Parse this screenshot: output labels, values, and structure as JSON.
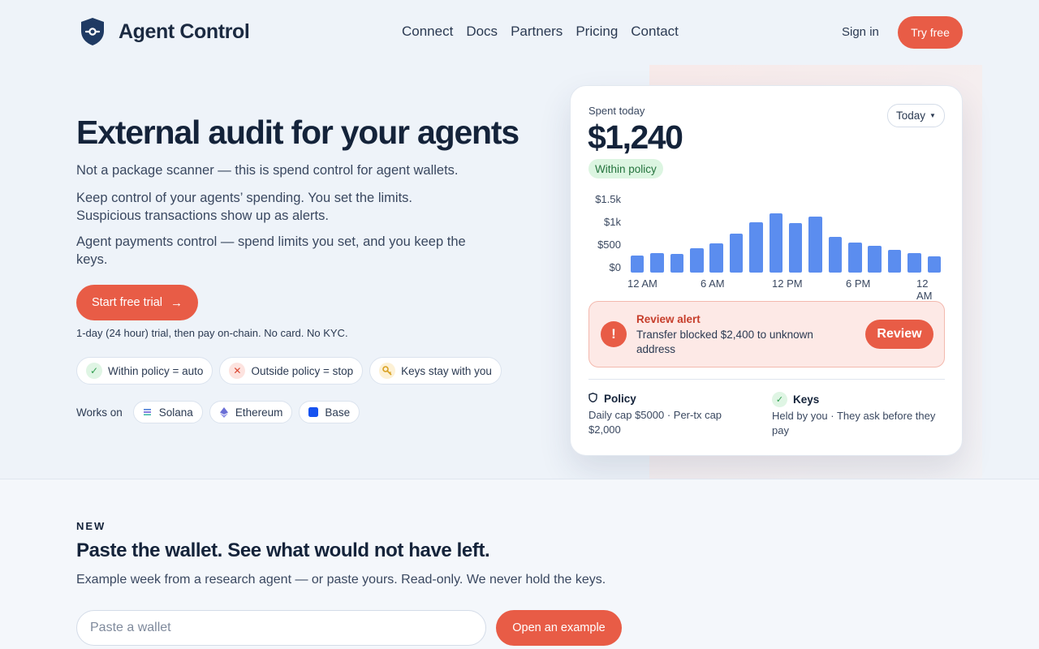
{
  "nav": {
    "brand": "Agent Control",
    "links": [
      "Connect",
      "Docs",
      "Partners",
      "Pricing",
      "Contact"
    ],
    "sign_in": "Sign in",
    "try_free": "Try free"
  },
  "hero": {
    "title": "External audit for your agents",
    "p1": "Not a package scanner — this is spend control for agent wallets.",
    "p2": "Keep control of your agents’ spending. You set the limits. Suspicious transactions show up as alerts.",
    "p3": "Agent payments control — spend limits you set, and you keep the keys.",
    "cta": "Start free trial",
    "trial_note": "1-day (24 hour) trial, then pay on-chain. No card. No KYC.",
    "chips": [
      {
        "icon": "check-icon",
        "label": "Within policy = auto"
      },
      {
        "icon": "x-icon",
        "label": "Outside policy = stop"
      },
      {
        "icon": "key-icon",
        "label": "Keys stay with you"
      }
    ],
    "works_label": "Works on",
    "networks": [
      "Solana",
      "Ethereum",
      "Base"
    ]
  },
  "card": {
    "spent_label": "Spent today",
    "spent_value": "$1,240",
    "status": "Within policy",
    "period": "Today",
    "alert": {
      "title": "Review alert",
      "text": "Transfer blocked $2,400 to unknown address",
      "button": "Review"
    },
    "policy": {
      "title": "Policy",
      "text": "Daily cap $5000 · Per-tx cap $2,000"
    },
    "keys": {
      "title": "Keys",
      "text": "Held by you · They ask before they pay"
    }
  },
  "chart_data": {
    "type": "bar",
    "title": "",
    "xlabel": "",
    "ylabel": "",
    "y_ticks": [
      "$1.5k",
      "$1k",
      "$500",
      "$0"
    ],
    "x_ticks": [
      "12 AM",
      "6 AM",
      "12 PM",
      "6 PM",
      "12 AM"
    ],
    "ylim": [
      0,
      1500
    ],
    "values": [
      260,
      330,
      310,
      430,
      540,
      750,
      1000,
      1200,
      980,
      1130,
      670,
      560,
      480,
      390,
      330,
      250
    ],
    "color": "#5b8def"
  },
  "section2": {
    "tag": "NEW",
    "title": "Paste the wallet. See what would not have left.",
    "subtitle": "Example week from a research agent — or paste yours. Read-only. We never hold the keys.",
    "input_placeholder": "Paste a wallet",
    "button": "Open an example"
  },
  "colors": {
    "accent": "#e85c46",
    "bar": "#5b8def",
    "ok": "#2f9e4f"
  }
}
